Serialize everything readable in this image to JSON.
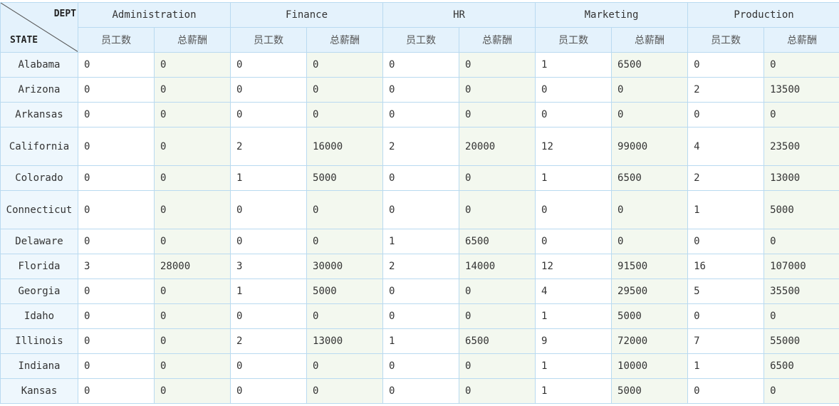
{
  "corner": {
    "top_label": "DEPT",
    "bottom_label": "STATE"
  },
  "departments": [
    "Administration",
    "Finance",
    "HR",
    "Marketing",
    "Production"
  ],
  "subheaders": {
    "count": "员工数",
    "salary": "总薪酬"
  },
  "rows": [
    {
      "state": "Alabama",
      "values": [
        "0",
        "0",
        "0",
        "0",
        "0",
        "0",
        "1",
        "6500",
        "0",
        "0"
      ]
    },
    {
      "state": "Arizona",
      "values": [
        "0",
        "0",
        "0",
        "0",
        "0",
        "0",
        "0",
        "0",
        "2",
        "13500"
      ]
    },
    {
      "state": "Arkansas",
      "values": [
        "0",
        "0",
        "0",
        "0",
        "0",
        "0",
        "0",
        "0",
        "0",
        "0"
      ]
    },
    {
      "state": "California",
      "values": [
        "0",
        "0",
        "2",
        "16000",
        "2",
        "20000",
        "12",
        "99000",
        "4",
        "23500"
      ]
    },
    {
      "state": "Colorado",
      "values": [
        "0",
        "0",
        "1",
        "5000",
        "0",
        "0",
        "1",
        "6500",
        "2",
        "13000"
      ]
    },
    {
      "state": "Connecticut",
      "values": [
        "0",
        "0",
        "0",
        "0",
        "0",
        "0",
        "0",
        "0",
        "1",
        "5000"
      ]
    },
    {
      "state": "Delaware",
      "values": [
        "0",
        "0",
        "0",
        "0",
        "1",
        "6500",
        "0",
        "0",
        "0",
        "0"
      ]
    },
    {
      "state": "Florida",
      "values": [
        "3",
        "28000",
        "3",
        "30000",
        "2",
        "14000",
        "12",
        "91500",
        "16",
        "107000"
      ]
    },
    {
      "state": "Georgia",
      "values": [
        "0",
        "0",
        "1",
        "5000",
        "0",
        "0",
        "4",
        "29500",
        "5",
        "35500"
      ]
    },
    {
      "state": "Idaho",
      "values": [
        "0",
        "0",
        "0",
        "0",
        "0",
        "0",
        "1",
        "5000",
        "0",
        "0"
      ]
    },
    {
      "state": "Illinois",
      "values": [
        "0",
        "0",
        "2",
        "13000",
        "1",
        "6500",
        "9",
        "72000",
        "7",
        "55000"
      ]
    },
    {
      "state": "Indiana",
      "values": [
        "0",
        "0",
        "0",
        "0",
        "0",
        "0",
        "1",
        "10000",
        "1",
        "6500"
      ]
    },
    {
      "state": "Kansas",
      "values": [
        "0",
        "0",
        "0",
        "0",
        "0",
        "0",
        "1",
        "5000",
        "0",
        "0"
      ]
    }
  ]
}
